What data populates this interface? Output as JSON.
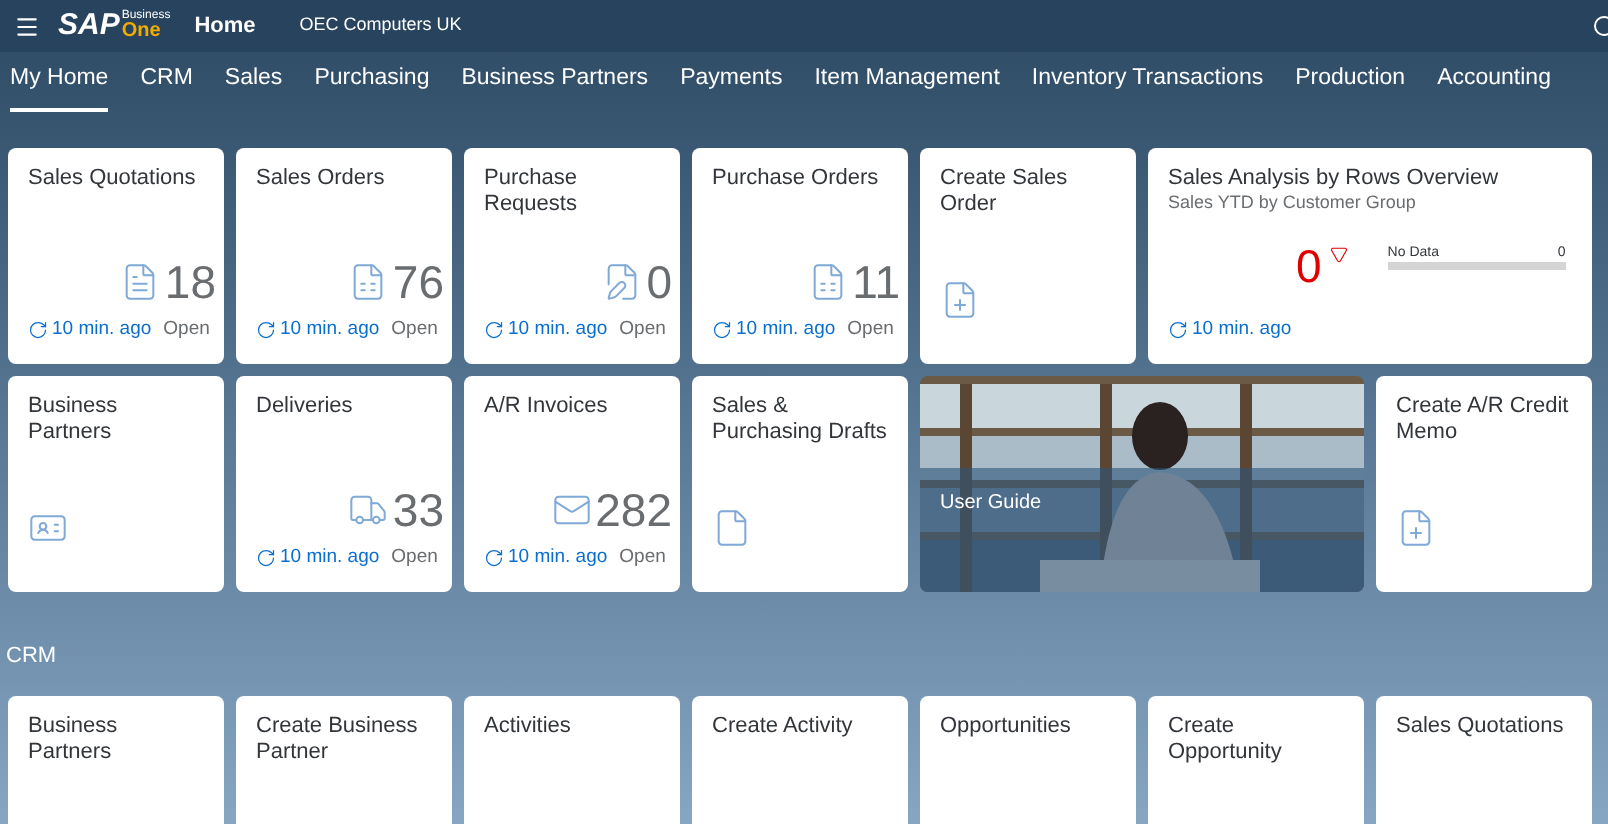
{
  "header": {
    "logo": "SAP",
    "logo_top": "Business",
    "logo_bottom": "One",
    "home": "Home",
    "company": "OEC Computers UK"
  },
  "tabs": [
    {
      "label": "My Home",
      "selected": true
    },
    {
      "label": "CRM",
      "selected": false
    },
    {
      "label": "Sales",
      "selected": false
    },
    {
      "label": "Purchasing",
      "selected": false
    },
    {
      "label": "Business Partners",
      "selected": false
    },
    {
      "label": "Payments",
      "selected": false
    },
    {
      "label": "Item Management",
      "selected": false
    },
    {
      "label": "Inventory Transactions",
      "selected": false
    },
    {
      "label": "Production",
      "selected": false
    },
    {
      "label": "Accounting",
      "selected": false
    }
  ],
  "sections": [
    {
      "tiles": [
        {
          "kind": "kpi",
          "title": "Sales Quotations",
          "value": "18",
          "refreshed": "10 min. ago",
          "status": "Open"
        },
        {
          "kind": "kpi",
          "title": "Sales Orders",
          "value": "76",
          "refreshed": "10 min. ago",
          "status": "Open"
        },
        {
          "kind": "kpi",
          "title": "Purchase Requests",
          "value": "0",
          "refreshed": "10 min. ago",
          "status": "Open"
        },
        {
          "kind": "kpi",
          "title": "Purchase Orders",
          "value": "11",
          "refreshed": "10 min. ago",
          "status": "Open"
        },
        {
          "kind": "launch",
          "title": "Create Sales Order"
        },
        {
          "kind": "analysis",
          "title": "Sales Analysis by Rows Overview",
          "subtitle": "Sales YTD by Customer Group",
          "value": "0",
          "bar_label": "No Data",
          "bar_value": "0",
          "refreshed": "10 min. ago"
        },
        {
          "kind": "launch",
          "title": "Business Partners"
        },
        {
          "kind": "kpi",
          "title": "Deliveries",
          "value": "33",
          "refreshed": "10 min. ago",
          "status": "Open"
        },
        {
          "kind": "kpi",
          "title": "A/R Invoices",
          "value": "282",
          "refreshed": "10 min. ago",
          "status": "Open"
        },
        {
          "kind": "launch",
          "title": "Sales & Purchasing Drafts"
        },
        {
          "kind": "picture",
          "title": "User Guide"
        },
        {
          "kind": "launch",
          "title": "Create A/R Credit Memo"
        }
      ]
    },
    {
      "title": "CRM",
      "tiles": [
        {
          "kind": "launch",
          "title": "Business Partners"
        },
        {
          "kind": "launch",
          "title": "Create Business Partner"
        },
        {
          "kind": "launch",
          "title": "Activities"
        },
        {
          "kind": "launch",
          "title": "Create Activity"
        },
        {
          "kind": "launch",
          "title": "Opportunities"
        },
        {
          "kind": "launch",
          "title": "Create Opportunity"
        },
        {
          "kind": "launch",
          "title": "Sales Quotations"
        }
      ]
    }
  ]
}
